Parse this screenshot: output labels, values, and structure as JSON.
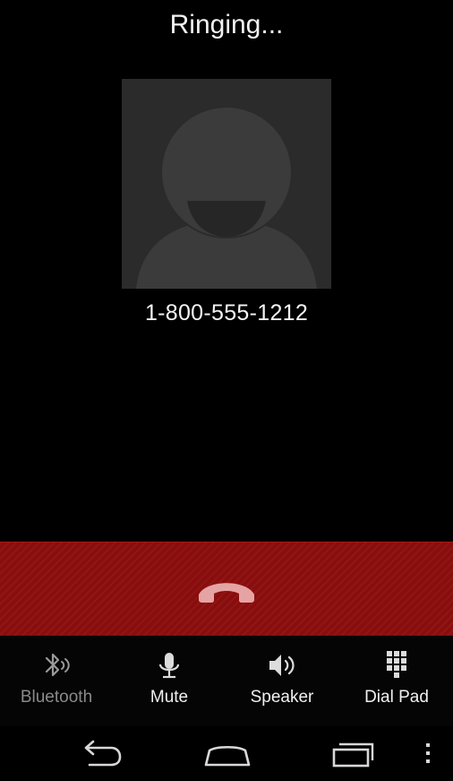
{
  "call": {
    "status": "Ringing...",
    "number": "1-800-555-1212"
  },
  "controls": [
    {
      "label": "Bluetooth",
      "icon": "bluetooth-icon",
      "enabled": false
    },
    {
      "label": "Mute",
      "icon": "microphone-icon",
      "enabled": true
    },
    {
      "label": "Speaker",
      "icon": "speaker-icon",
      "enabled": true
    },
    {
      "label": "Dial Pad",
      "icon": "dialpad-icon",
      "enabled": true
    }
  ],
  "end_call": {
    "icon": "hang-up-icon"
  },
  "navbar": {
    "buttons": [
      "back-icon",
      "home-icon",
      "recent-apps-icon",
      "overflow-menu-icon"
    ]
  },
  "colors": {
    "background": "#000000",
    "end_call_bar": "#8a0d0d",
    "hangup_icon": "#e6a3a3",
    "avatar_bg": "#2b2b2b",
    "disabled_label": "#8a8a8a"
  }
}
